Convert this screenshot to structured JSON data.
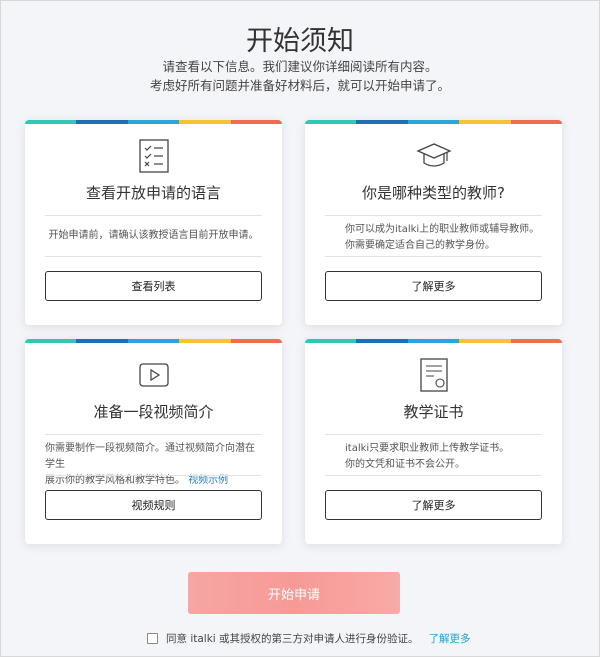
{
  "header": {
    "title": "开始须知",
    "subtitle_line1": "请查看以下信息。我们建议你详细阅读所有内容。",
    "subtitle_line2": "考虑好所有问题并准备好材料后，就可以开始申请了。"
  },
  "stripe_colors": [
    "#2fc8b4",
    "#1f6fb5",
    "#27a6d9",
    "#f6c332",
    "#f26a4f"
  ],
  "cards": [
    {
      "icon": "checklist-icon",
      "title": "查看开放申请的语言",
      "desc_line1": "开始申请前，请确认该教授语言目前开放申请。",
      "desc_line2": "",
      "desc_link": "",
      "button": "查看列表"
    },
    {
      "icon": "graduation-cap-icon",
      "title": "你是哪种类型的教师?",
      "desc_line1": "你可以成为italki上的职业教师或辅导教师。",
      "desc_line2": "你需要确定适合自己的教学身份。",
      "desc_link": "",
      "button": "了解更多"
    },
    {
      "icon": "video-play-icon",
      "title": "准备一段视频简介",
      "desc_line1": "你需要制作一段视频简介。通过视频简介向潜在学生",
      "desc_line2": "展示你的教学风格和教学特色。",
      "desc_link": "视频示例",
      "button": "视频规则"
    },
    {
      "icon": "certificate-icon",
      "title": "教学证书",
      "desc_line1": "italki只要求职业教师上传教学证书。",
      "desc_line2": "你的文凭和证书不会公开。",
      "desc_link": "",
      "button": "了解更多"
    }
  ],
  "start_button": "开始申请",
  "agreement": {
    "text": "同意 italki 或其授权的第三方对申请人进行身份验证。",
    "link": "了解更多"
  }
}
